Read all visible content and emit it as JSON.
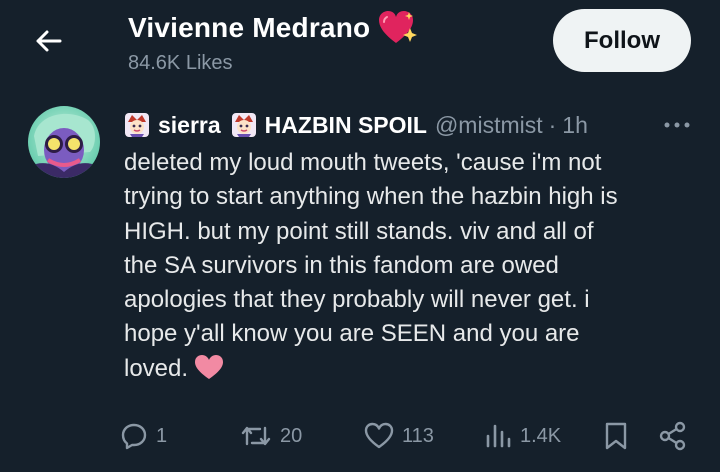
{
  "header": {
    "profile_name": "Vivienne Medrano",
    "likes": "84.6K Likes",
    "follow_label": "Follow",
    "name_emoji": "sparkling-heart-icon",
    "back_icon": "arrow-left-icon"
  },
  "tweet": {
    "author_name_part1": "sierra",
    "author_name_part2": "HAZBIN SPOIL",
    "handle": "@mistmist",
    "separator": "·",
    "time": "1h",
    "lines": [
      "deleted my loud mouth tweets, 'cause i'm not",
      "trying to start anything when the hazbin high is",
      "HIGH. but my point still stands. viv and all of",
      "the SA survivors in this fandom are owed",
      "apologies that they probably will never get. i",
      "hope y'all know you are SEEN and you are",
      "loved."
    ],
    "end_emoji": "pink-heart-icon"
  },
  "actions": {
    "replies": "1",
    "reposts": "20",
    "likes": "113",
    "views": "1.4K"
  },
  "colors": {
    "background": "#15202b",
    "secondary_text": "#8b98a5",
    "follow_bg": "#eff3f4",
    "heart_pink": "#f28aa3",
    "name_heart_red": "#e0245e"
  }
}
